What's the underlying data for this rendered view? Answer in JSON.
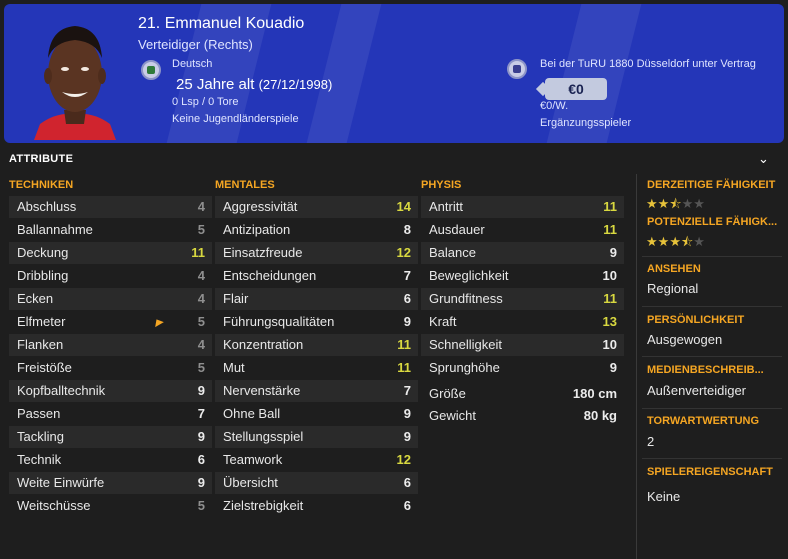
{
  "player": {
    "name": "21. Emmanuel Kouadio",
    "position": "Verteidiger (Rechts)",
    "nationality": "Deutsch",
    "age": "25 Jahre alt",
    "dob": "(27/12/1998)",
    "caps": "0 Lsp / 0 Tore",
    "youth_caps": "Keine Jugendländerspiele",
    "contract": "Bei der TuRU 1880 Düsseldorf unter Vertrag",
    "value": "€0",
    "wage": "€0/W.",
    "role": "Ergänzungsspieler"
  },
  "section": {
    "title": "ATTRIBUTE"
  },
  "columns": {
    "techniken": {
      "title": "TECHNIKEN",
      "items": [
        {
          "name": "Abschluss",
          "value": "4"
        },
        {
          "name": "Ballannahme",
          "value": "5"
        },
        {
          "name": "Deckung",
          "value": "11"
        },
        {
          "name": "Dribbling",
          "value": "4"
        },
        {
          "name": "Ecken",
          "value": "4"
        },
        {
          "name": "Elfmeter",
          "value": "5"
        },
        {
          "name": "Flanken",
          "value": "4"
        },
        {
          "name": "Freistöße",
          "value": "5"
        },
        {
          "name": "Kopfballtechnik",
          "value": "9"
        },
        {
          "name": "Passen",
          "value": "7"
        },
        {
          "name": "Tackling",
          "value": "9"
        },
        {
          "name": "Technik",
          "value": "6"
        },
        {
          "name": "Weite Einwürfe",
          "value": "9"
        },
        {
          "name": "Weitschüsse",
          "value": "5"
        }
      ]
    },
    "mentales": {
      "title": "MENTALES",
      "items": [
        {
          "name": "Aggressivität",
          "value": "14"
        },
        {
          "name": "Antizipation",
          "value": "8"
        },
        {
          "name": "Einsatzfreude",
          "value": "12"
        },
        {
          "name": "Entscheidungen",
          "value": "7"
        },
        {
          "name": "Flair",
          "value": "6"
        },
        {
          "name": "Führungsqualitäten",
          "value": "9"
        },
        {
          "name": "Konzentration",
          "value": "11"
        },
        {
          "name": "Mut",
          "value": "11"
        },
        {
          "name": "Nervenstärke",
          "value": "7"
        },
        {
          "name": "Ohne Ball",
          "value": "9"
        },
        {
          "name": "Stellungsspiel",
          "value": "9"
        },
        {
          "name": "Teamwork",
          "value": "12"
        },
        {
          "name": "Übersicht",
          "value": "6"
        },
        {
          "name": "Zielstrebigkeit",
          "value": "6"
        }
      ]
    },
    "physis": {
      "title": "PHYSIS",
      "items": [
        {
          "name": "Antritt",
          "value": "11"
        },
        {
          "name": "Ausdauer",
          "value": "11"
        },
        {
          "name": "Balance",
          "value": "9"
        },
        {
          "name": "Beweglichkeit",
          "value": "10"
        },
        {
          "name": "Grundfitness",
          "value": "11"
        },
        {
          "name": "Kraft",
          "value": "13"
        },
        {
          "name": "Schnelligkeit",
          "value": "10"
        },
        {
          "name": "Sprunghöhe",
          "value": "9"
        }
      ],
      "extra": [
        {
          "name": "Größe",
          "value": "180 cm"
        },
        {
          "name": "Gewicht",
          "value": "80 kg"
        }
      ]
    }
  },
  "sidebar": {
    "current_ability": {
      "title": "DERZEITIGE FÄHIGKEIT",
      "stars": 2.5
    },
    "potential_ability": {
      "title": "POTENZIELLE FÄHIGK...",
      "stars": 3.5
    },
    "reputation": {
      "title": "ANSEHEN",
      "value": "Regional"
    },
    "personality": {
      "title": "PERSÖNLICHKEIT",
      "value": "Ausgewogen"
    },
    "media": {
      "title": "MEDIENBESCHREIB...",
      "value": "Außenverteidiger"
    },
    "gk_rating": {
      "title": "TORWARTWERTUNG",
      "value": "2"
    },
    "traits": {
      "title": "SPIELEREIGENSCHAFT",
      "value": "Keine"
    }
  },
  "colors": {
    "header_bg": "#2436b8",
    "accent": "#f5a623",
    "good_value": "#d8d840",
    "low_value": "#8f8f8f"
  }
}
